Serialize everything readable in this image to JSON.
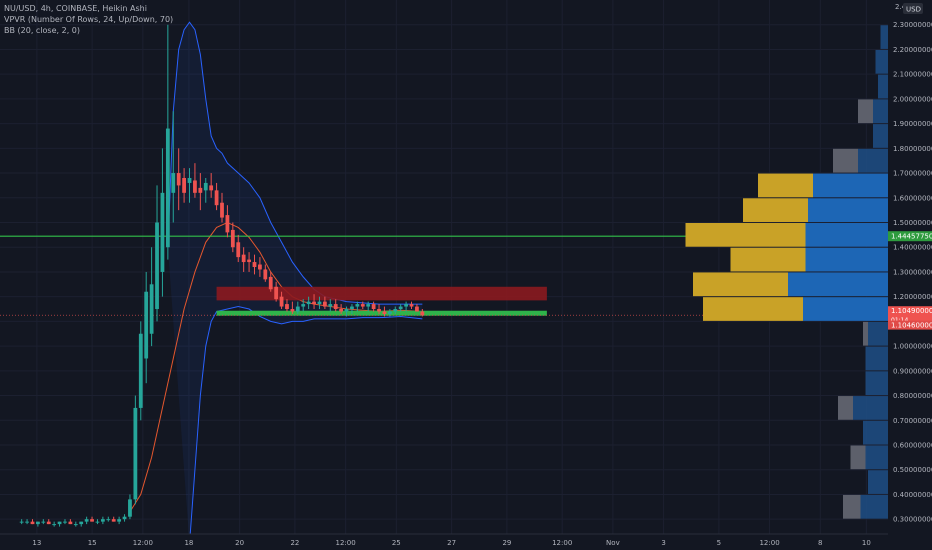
{
  "legend": {
    "line1": "NU/USD, 4h, COINBASE, Heikin Ashi",
    "line2": "VPVR (Number Of Rows, 24, Up/Down, 70)",
    "line3": "BB (20, close, 2, 0)"
  },
  "currency_badge": "USD",
  "axis_top_label": "2.4",
  "price_labels": {
    "green_line": "1.44457750",
    "current_price": "1.10490000",
    "current_sub": "01:14",
    "bb_lower": "1.10460000"
  },
  "colors": {
    "background": "#131722",
    "up": "#26a69a",
    "down": "#ef5350",
    "resistance_zone": "#8b1a1f",
    "support_line": "#2fb34a",
    "horizontal_line": "#32c04a",
    "bb_band": "#2962ff",
    "ma_line": "#e4572e",
    "vp_up": "#1d66b5",
    "vp_down": "#c9a227",
    "vp_inactive": "#5d606b"
  },
  "chart_data": {
    "type": "candlestick",
    "symbol": "NU/USD",
    "interval": "4h",
    "exchange": "COINBASE",
    "style": "Heikin Ashi",
    "y_axis": {
      "ticks": [
        "2.30000000",
        "2.20000000",
        "2.10000000",
        "2.00000000",
        "1.90000000",
        "1.80000000",
        "1.70000000",
        "1.60000000",
        "1.50000000",
        "1.40000000",
        "1.30000000",
        "1.20000000",
        "1.10000000",
        "1.00000000",
        "0.90000000",
        "0.80000000",
        "0.70000000",
        "0.60000000",
        "0.50000000",
        "0.40000000",
        "0.30000000"
      ],
      "range": [
        0.24,
        2.4
      ]
    },
    "x_axis": {
      "ticks": [
        "13",
        "15",
        "12:00",
        "18",
        "20",
        "22",
        "12:00",
        "25",
        "27",
        "29",
        "12:00",
        "Nov",
        "3",
        "5",
        "12:00",
        "8",
        "10"
      ],
      "range_bars": [
        -4,
        160
      ]
    },
    "horizontal_line": 1.4446,
    "resistance_zone": {
      "from_bar": 0,
      "to_bar": 160,
      "low": 1.185,
      "high": 1.24
    },
    "support_line": {
      "from_bar": 0,
      "to_bar": 160,
      "value": 1.133
    },
    "candles": [
      [
        0.29,
        0.3,
        0.28,
        0.29
      ],
      [
        0.29,
        0.3,
        0.28,
        0.29
      ],
      [
        0.29,
        0.3,
        0.28,
        0.28
      ],
      [
        0.28,
        0.29,
        0.27,
        0.29
      ],
      [
        0.29,
        0.3,
        0.28,
        0.29
      ],
      [
        0.29,
        0.3,
        0.28,
        0.28
      ],
      [
        0.28,
        0.29,
        0.27,
        0.28
      ],
      [
        0.28,
        0.29,
        0.27,
        0.29
      ],
      [
        0.29,
        0.3,
        0.28,
        0.29
      ],
      [
        0.29,
        0.3,
        0.28,
        0.28
      ],
      [
        0.28,
        0.29,
        0.27,
        0.28
      ],
      [
        0.28,
        0.29,
        0.27,
        0.29
      ],
      [
        0.29,
        0.31,
        0.28,
        0.3
      ],
      [
        0.3,
        0.31,
        0.29,
        0.29
      ],
      [
        0.29,
        0.3,
        0.28,
        0.29
      ],
      [
        0.29,
        0.31,
        0.28,
        0.3
      ],
      [
        0.3,
        0.31,
        0.29,
        0.3
      ],
      [
        0.3,
        0.31,
        0.29,
        0.29
      ],
      [
        0.29,
        0.31,
        0.28,
        0.3
      ],
      [
        0.3,
        0.32,
        0.29,
        0.31
      ],
      [
        0.31,
        0.4,
        0.3,
        0.38
      ],
      [
        0.38,
        0.8,
        0.36,
        0.75
      ],
      [
        0.75,
        1.1,
        0.7,
        1.05
      ],
      [
        0.95,
        1.3,
        0.85,
        1.22
      ],
      [
        1.05,
        1.4,
        1.0,
        1.25
      ],
      [
        1.15,
        1.65,
        1.1,
        1.5
      ],
      [
        1.3,
        1.8,
        1.2,
        1.62
      ],
      [
        1.4,
        2.3,
        1.35,
        1.88
      ],
      [
        1.62,
        1.95,
        1.5,
        1.7
      ],
      [
        1.7,
        1.8,
        1.55,
        1.65
      ],
      [
        1.68,
        1.72,
        1.58,
        1.62
      ],
      [
        1.66,
        1.72,
        1.58,
        1.68
      ],
      [
        1.67,
        1.74,
        1.6,
        1.62
      ],
      [
        1.64,
        1.7,
        1.55,
        1.62
      ],
      [
        1.63,
        1.68,
        1.58,
        1.66
      ],
      [
        1.65,
        1.7,
        1.6,
        1.63
      ],
      [
        1.63,
        1.66,
        1.55,
        1.57
      ],
      [
        1.58,
        1.62,
        1.5,
        1.52
      ],
      [
        1.53,
        1.57,
        1.44,
        1.46
      ],
      [
        1.47,
        1.5,
        1.38,
        1.4
      ],
      [
        1.42,
        1.45,
        1.34,
        1.36
      ],
      [
        1.37,
        1.4,
        1.3,
        1.34
      ],
      [
        1.35,
        1.38,
        1.3,
        1.34
      ],
      [
        1.34,
        1.37,
        1.29,
        1.32
      ],
      [
        1.33,
        1.36,
        1.28,
        1.31
      ],
      [
        1.31,
        1.33,
        1.26,
        1.27
      ],
      [
        1.28,
        1.3,
        1.22,
        1.23
      ],
      [
        1.24,
        1.26,
        1.18,
        1.19
      ],
      [
        1.2,
        1.22,
        1.15,
        1.16
      ],
      [
        1.17,
        1.19,
        1.14,
        1.15
      ],
      [
        1.15,
        1.18,
        1.13,
        1.14
      ],
      [
        1.14,
        1.18,
        1.13,
        1.16
      ],
      [
        1.16,
        1.19,
        1.14,
        1.17
      ],
      [
        1.17,
        1.2,
        1.15,
        1.18
      ],
      [
        1.18,
        1.21,
        1.15,
        1.17
      ],
      [
        1.17,
        1.2,
        1.15,
        1.18
      ],
      [
        1.18,
        1.2,
        1.15,
        1.16
      ],
      [
        1.16,
        1.19,
        1.14,
        1.17
      ],
      [
        1.17,
        1.19,
        1.14,
        1.15
      ],
      [
        1.15,
        1.17,
        1.13,
        1.14
      ],
      [
        1.14,
        1.16,
        1.12,
        1.15
      ],
      [
        1.15,
        1.17,
        1.13,
        1.16
      ],
      [
        1.16,
        1.18,
        1.14,
        1.17
      ],
      [
        1.17,
        1.18,
        1.15,
        1.16
      ],
      [
        1.16,
        1.18,
        1.14,
        1.17
      ],
      [
        1.17,
        1.18,
        1.14,
        1.15
      ],
      [
        1.15,
        1.17,
        1.13,
        1.14
      ],
      [
        1.14,
        1.16,
        1.12,
        1.13
      ],
      [
        1.13,
        1.15,
        1.12,
        1.14
      ],
      [
        1.14,
        1.16,
        1.13,
        1.15
      ],
      [
        1.15,
        1.17,
        1.14,
        1.16
      ],
      [
        1.16,
        1.18,
        1.14,
        1.17
      ],
      [
        1.17,
        1.18,
        1.15,
        1.16
      ],
      [
        1.16,
        1.17,
        1.14,
        1.14
      ],
      [
        1.14,
        1.15,
        1.12,
        1.125
      ]
    ],
    "bb_upper": [
      [
        27,
        1.4
      ],
      [
        28,
        1.95
      ],
      [
        29,
        2.2
      ],
      [
        30,
        2.28
      ],
      [
        31,
        2.31
      ],
      [
        32,
        2.28
      ],
      [
        33,
        2.18
      ],
      [
        34,
        2.0
      ],
      [
        35,
        1.85
      ],
      [
        36,
        1.8
      ],
      [
        37,
        1.78
      ],
      [
        38,
        1.74
      ],
      [
        40,
        1.7
      ],
      [
        42,
        1.66
      ],
      [
        44,
        1.6
      ],
      [
        46,
        1.5
      ],
      [
        48,
        1.42
      ],
      [
        50,
        1.34
      ],
      [
        52,
        1.28
      ],
      [
        54,
        1.23
      ],
      [
        56,
        1.2
      ],
      [
        58,
        1.19
      ],
      [
        60,
        1.18
      ],
      [
        63,
        1.175
      ],
      [
        66,
        1.17
      ],
      [
        70,
        1.17
      ],
      [
        74,
        1.17
      ]
    ],
    "bb_lower": [
      [
        31,
        0.2
      ],
      [
        32,
        0.5
      ],
      [
        33,
        0.8
      ],
      [
        34,
        1.0
      ],
      [
        35,
        1.1
      ],
      [
        36,
        1.14
      ],
      [
        38,
        1.15
      ],
      [
        40,
        1.16
      ],
      [
        42,
        1.15
      ],
      [
        44,
        1.12
      ],
      [
        46,
        1.1
      ],
      [
        48,
        1.09
      ],
      [
        50,
        1.1
      ],
      [
        52,
        1.1
      ],
      [
        54,
        1.11
      ],
      [
        57,
        1.11
      ],
      [
        60,
        1.11
      ],
      [
        63,
        1.115
      ],
      [
        66,
        1.115
      ],
      [
        70,
        1.12
      ],
      [
        74,
        1.11
      ]
    ],
    "bb_basis": [
      [
        20,
        0.33
      ],
      [
        22,
        0.4
      ],
      [
        24,
        0.55
      ],
      [
        26,
        0.75
      ],
      [
        28,
        0.95
      ],
      [
        30,
        1.15
      ],
      [
        32,
        1.3
      ],
      [
        34,
        1.42
      ],
      [
        36,
        1.48
      ],
      [
        38,
        1.5
      ],
      [
        40,
        1.48
      ],
      [
        42,
        1.44
      ],
      [
        44,
        1.38
      ],
      [
        46,
        1.3
      ],
      [
        48,
        1.24
      ],
      [
        50,
        1.2
      ],
      [
        52,
        1.18
      ],
      [
        54,
        1.17
      ],
      [
        57,
        1.16
      ],
      [
        60,
        1.15
      ],
      [
        63,
        1.145
      ],
      [
        66,
        1.14
      ],
      [
        70,
        1.145
      ],
      [
        74,
        1.14
      ]
    ],
    "volume_profile": {
      "row_height": 0.1,
      "rows": [
        {
          "low": 0.3,
          "up": 0.55,
          "down": 0.35
        },
        {
          "low": 0.4,
          "up": 0.4,
          "down": 0
        },
        {
          "low": 0.5,
          "up": 0.45,
          "down": 0.3
        },
        {
          "low": 0.6,
          "up": 0.5,
          "down": 0
        },
        {
          "low": 0.7,
          "up": 0.7,
          "down": 0.3
        },
        {
          "low": 0.8,
          "up": 0.45,
          "down": 0
        },
        {
          "low": 0.9,
          "up": 0.45,
          "down": 0
        },
        {
          "low": 1.0,
          "up": 0.4,
          "down": 0.1
        },
        {
          "low": 1.1,
          "up": 1.7,
          "down": 2.0
        },
        {
          "low": 1.2,
          "up": 2.0,
          "down": 1.9
        },
        {
          "low": 1.3,
          "up": 1.65,
          "down": 1.5
        },
        {
          "low": 1.4,
          "up": 1.65,
          "down": 2.4
        },
        {
          "low": 1.5,
          "up": 1.6,
          "down": 1.3
        },
        {
          "low": 1.6,
          "up": 1.5,
          "down": 1.1
        },
        {
          "low": 1.7,
          "up": 0.6,
          "down": 0.5
        },
        {
          "low": 1.8,
          "up": 0.3,
          "down": 0
        },
        {
          "low": 1.9,
          "up": 0.3,
          "down": 0.3
        },
        {
          "low": 2.0,
          "up": 0.2,
          "down": 0
        },
        {
          "low": 2.1,
          "up": 0.25,
          "down": 0
        },
        {
          "low": 2.2,
          "up": 0.15,
          "down": 0
        }
      ]
    }
  }
}
